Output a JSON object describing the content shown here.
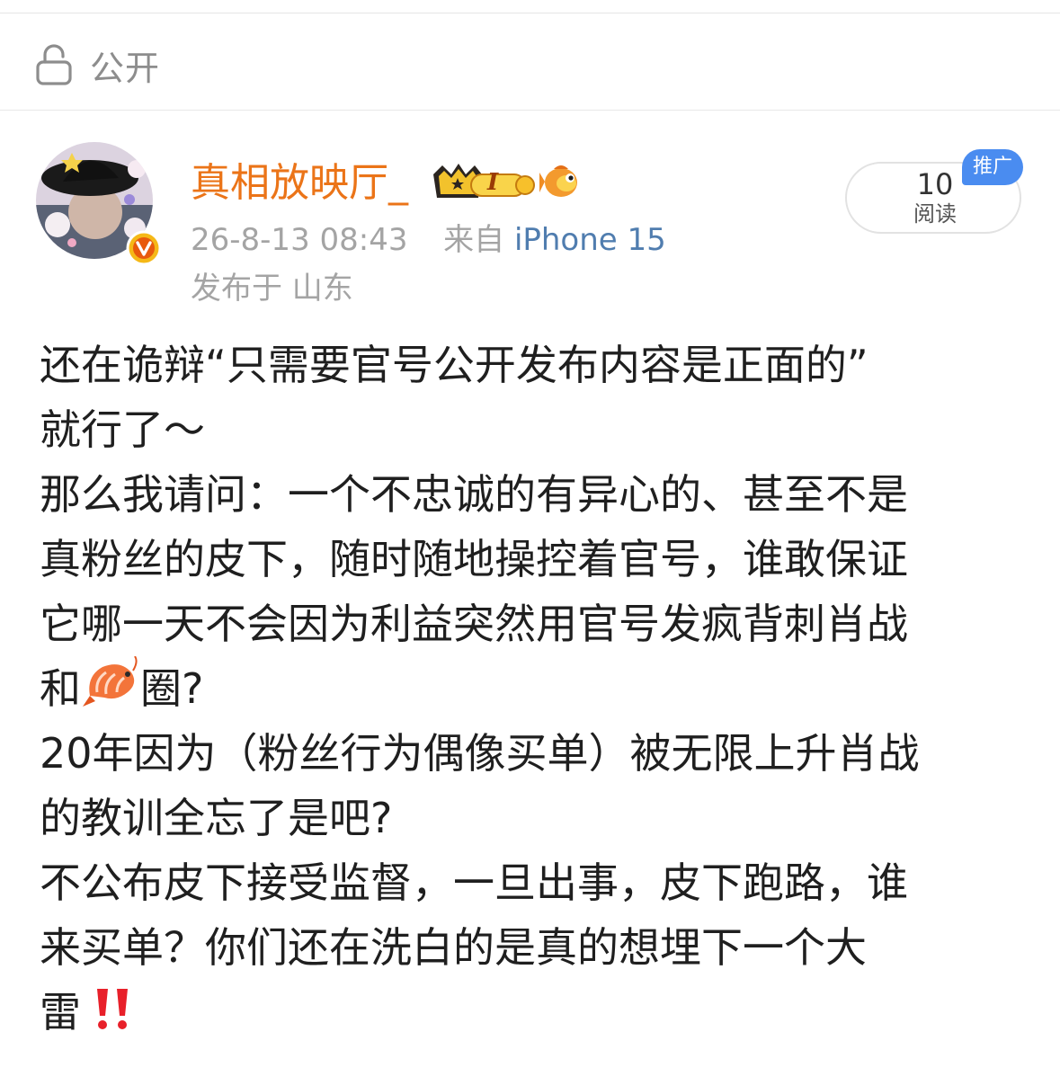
{
  "visibility": {
    "icon": "lock-open-icon",
    "label": "公开"
  },
  "author": {
    "name": "真相放映厅_",
    "avatar_icon": "avatar-image",
    "verified_icon": "verified-v-badge-icon",
    "crown_badge_label": "I",
    "crown_icon": "crown-level-badge-icon",
    "fan_icon": "goldfish-icon",
    "name_color": "#eb7418"
  },
  "meta": {
    "timestamp": "26-8-13 08:43",
    "source_prefix": "来自",
    "source": "iPhone 15",
    "location": "发布于 山东"
  },
  "read_counter": {
    "count": "10",
    "label": "阅读",
    "promo_tag": "推广"
  },
  "post": {
    "lines": [
      "还在诡辩“只需要官号公开发布内容是正面的”",
      "就行了～",
      "那么我请问：一个不忠诚的有异心的、甚至不是",
      "真粉丝的皮下，随时随地操控着官号，谁敢保证",
      "它哪一天不会因为利益突然用官号发疯背刺肖战",
      "20年因为（粉丝行为偶像买单）被无限上升肖战",
      "的教训全忘了是吧?",
      "不公布皮下接受监督，一旦出事，皮下跑路，谁",
      "来买单？你们还在洗白的是真的想埋下一个大"
    ],
    "line_with_emoji_before": "和",
    "line_with_emoji_after": "圈?",
    "emoji_inline": "shrimp-icon",
    "last_line_text": "雷",
    "last_line_emoji": "double-exclamation-icon"
  },
  "colors": {
    "accent_orange": "#eb7418",
    "link_blue": "#507daf",
    "promo_blue": "#4a8cf0",
    "meta_gray": "#a4a4a4"
  }
}
